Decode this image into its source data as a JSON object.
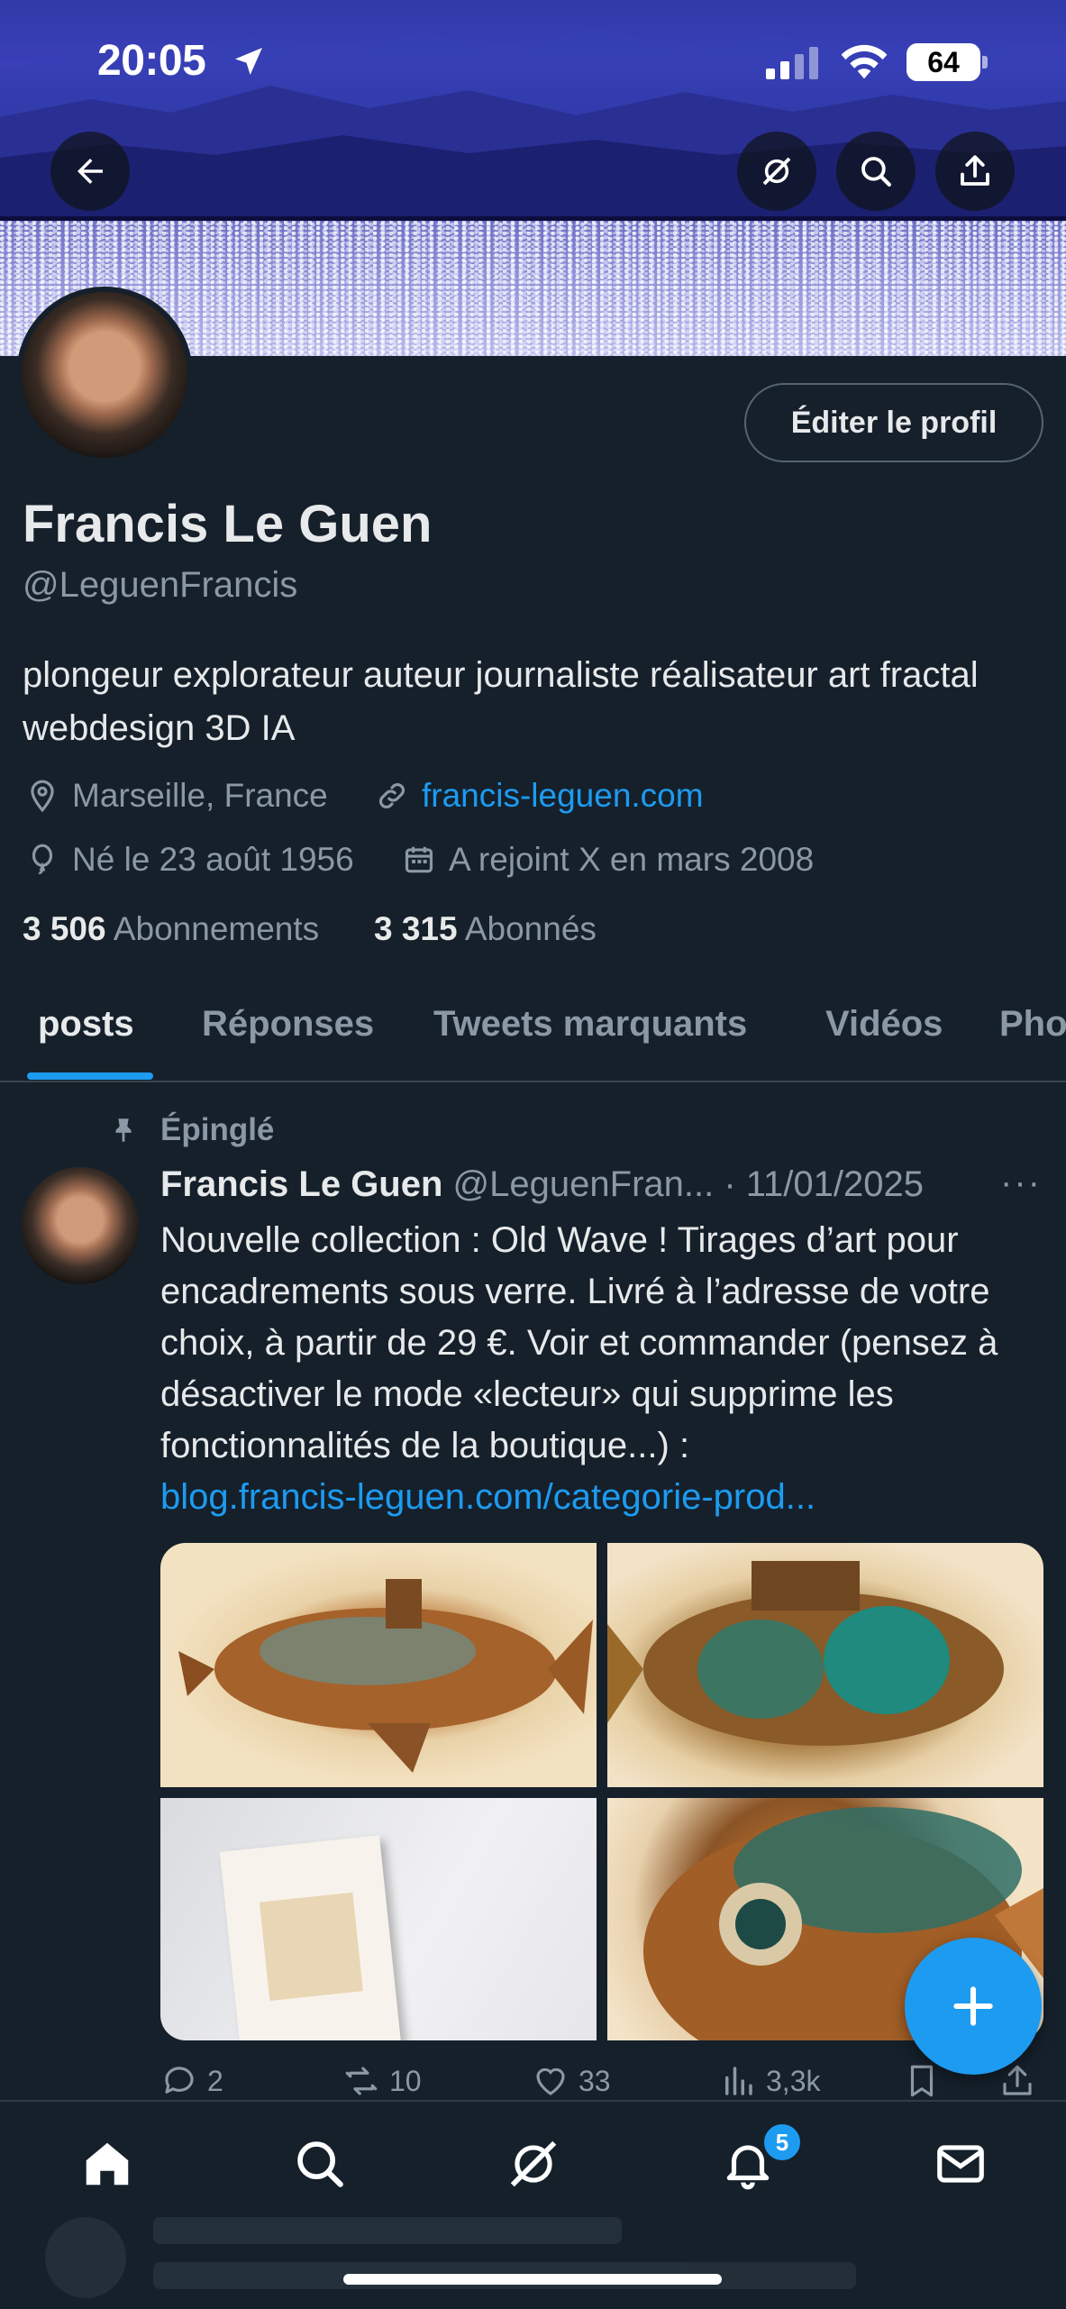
{
  "status_bar": {
    "time": "20:05",
    "battery": "64"
  },
  "header": {
    "back_icon": "arrow-left-icon",
    "grok_icon": "grok-icon",
    "search_icon": "search-icon",
    "share_icon": "share-icon"
  },
  "profile": {
    "edit_label": "Éditer le profil",
    "name": "Francis Le Guen",
    "handle": "@LeguenFrancis",
    "bio": "plongeur explorateur auteur journaliste réalisateur art fractal webdesign 3D IA",
    "location": "Marseille, France",
    "website": "francis-leguen.com",
    "birth": "Né le 23 août 1956",
    "joined": "A rejoint X en mars 2008",
    "following_count": "3 506",
    "following_label": "Abonnements",
    "followers_count": "3 315",
    "followers_label": "Abonnés"
  },
  "tabs": [
    {
      "label": "posts"
    },
    {
      "label": "Réponses"
    },
    {
      "label": "Tweets marquants"
    },
    {
      "label": "Vidéos"
    },
    {
      "label": "Pho"
    }
  ],
  "post": {
    "pinned_label": "Épinglé",
    "author": "Francis Le Guen",
    "handle_date": "@LeguenFran... · 11/01/2025",
    "more": "···",
    "text": "Nouvelle collection : Old Wave ! Tirages d’art pour encadrements sous verre. Livré à l’adresse de votre choix, à partir de 29 €. Voir et commander (pensez à désactiver le mode «lecteur» qui supprime les fonctionnalités de la boutique...) :",
    "link": "blog.francis-leguen.com/categorie-prod...",
    "stats": {
      "replies": "2",
      "reposts": "10",
      "likes": "33",
      "views": "3,3k"
    }
  },
  "notifications_badge": "5",
  "colors": {
    "background": "#15202b",
    "accent": "#1d9bf0",
    "muted": "#8b98a5",
    "text": "#e7e9ea"
  }
}
